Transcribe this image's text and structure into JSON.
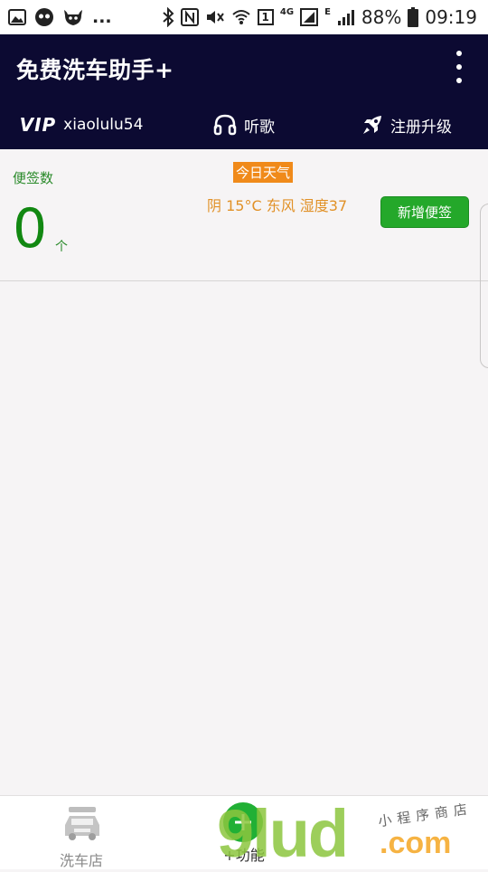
{
  "status_bar": {
    "left_icons": [
      "image-icon",
      "face-icon",
      "cow-icon"
    ],
    "more": "...",
    "network_label": "4G",
    "sim_badge": "1",
    "e_label": "E",
    "battery_percent": "88%",
    "time": "09:19"
  },
  "app": {
    "title": "免费洗车助手+"
  },
  "tabs": {
    "vip_logo": "VIP",
    "username": "xiaolulu54",
    "music_label": "听歌",
    "upgrade_label": "注册升级"
  },
  "notes": {
    "label": "便签数",
    "count": "0",
    "unit": "个",
    "add_button": "新增便签"
  },
  "weather": {
    "title": "今日天气",
    "info": "阴 15°C 东风 湿度37"
  },
  "bottom_nav": {
    "wash_label": "洗车店",
    "function_label": "+功能"
  },
  "watermark": {
    "brand": "9lud",
    "domain": ".com",
    "chinese": "小程序商店"
  },
  "colors": {
    "header_bg": "#0c0a32",
    "accent_green": "#24a82a",
    "weather_orange": "#f08a1a"
  }
}
